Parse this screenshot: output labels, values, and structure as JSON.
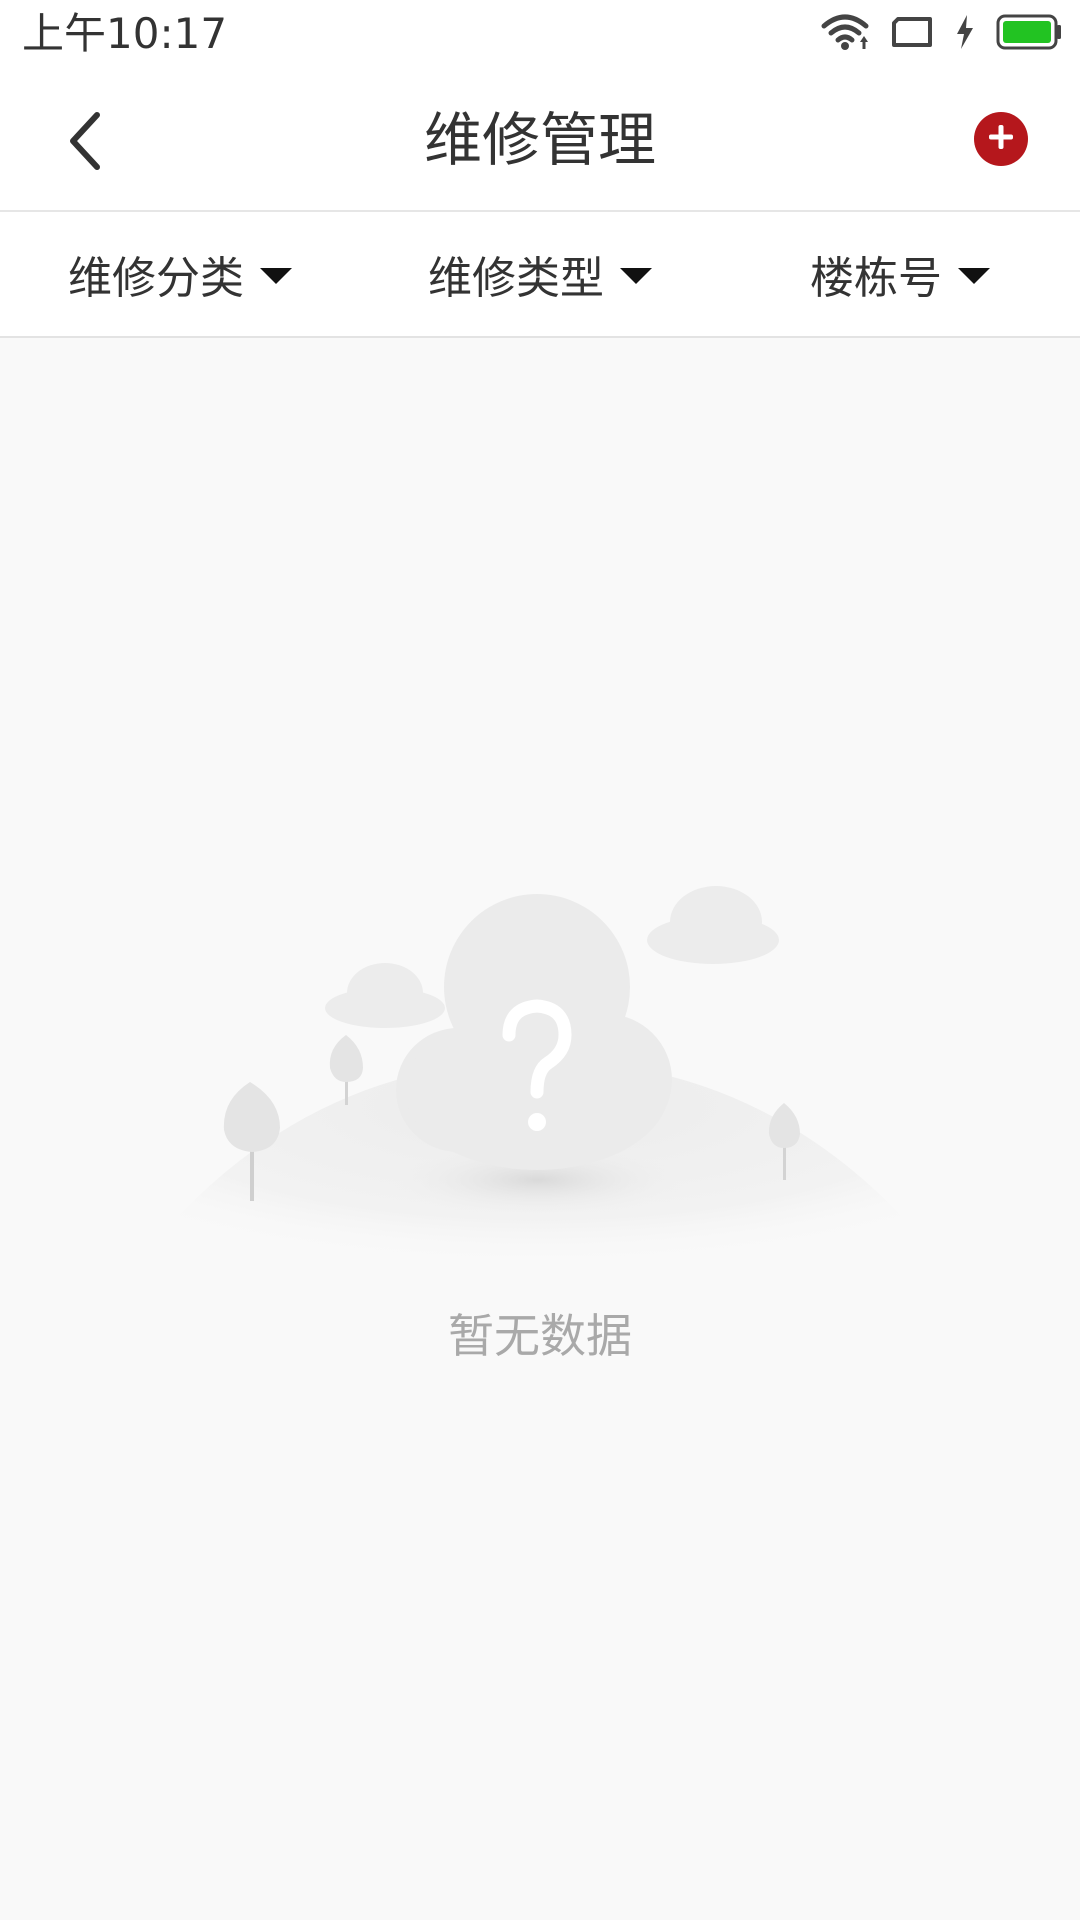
{
  "status_bar": {
    "time": "上午10:17",
    "icons": [
      "wifi-icon",
      "screen-rotation-icon",
      "charging-bolt-icon",
      "battery-icon"
    ],
    "battery_color": "#22c322"
  },
  "header": {
    "title": "维修管理",
    "back_icon": "chevron-left-icon",
    "add_icon": "plus-circle-icon",
    "add_button_color": "#b5171c"
  },
  "filters": [
    {
      "label": "维修分类",
      "icon": "caret-down-icon"
    },
    {
      "label": "维修类型",
      "icon": "caret-down-icon"
    },
    {
      "label": "楼栋号",
      "icon": "caret-down-icon"
    }
  ],
  "empty_state": {
    "message": "暂无数据",
    "illustration": "cloud-question-icon"
  }
}
